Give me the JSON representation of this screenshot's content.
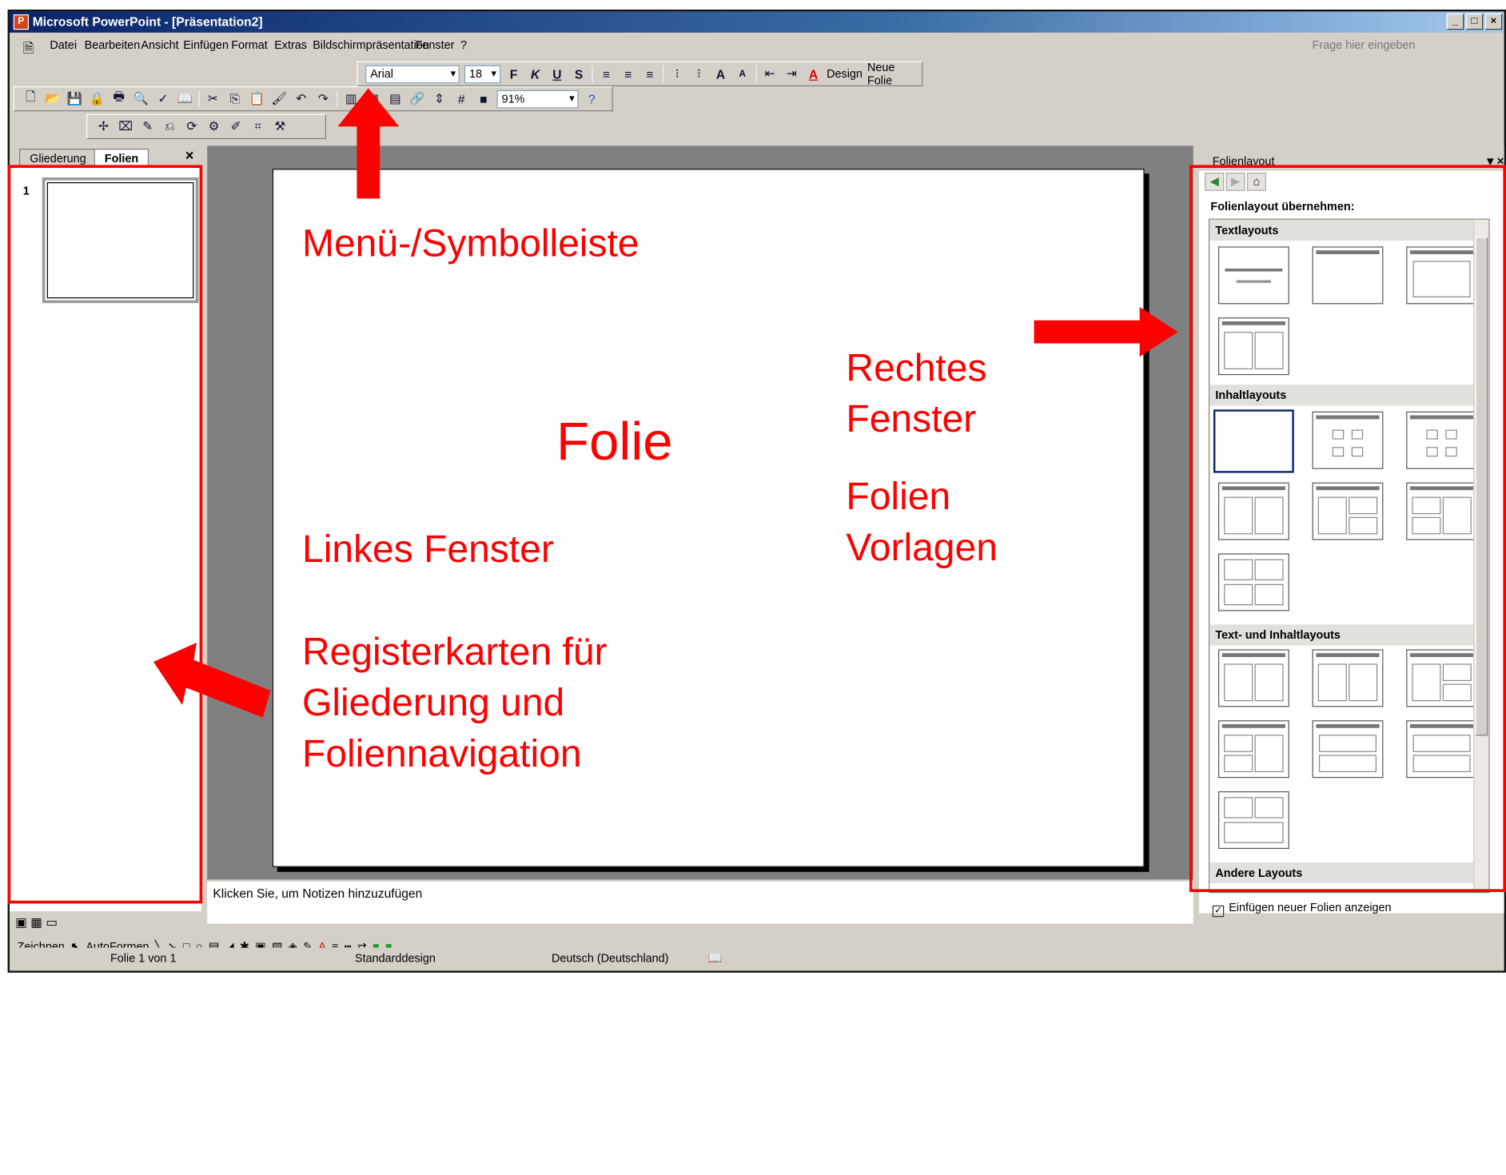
{
  "window": {
    "title": "Microsoft PowerPoint - [Präsentation2]",
    "app_icon": "powerpoint-icon"
  },
  "menu": [
    "Datei",
    "Bearbeiten",
    "Ansicht",
    "Einfügen",
    "Format",
    "Extras",
    "Bildschirmpräsentation",
    "Fenster",
    "?"
  ],
  "help_placeholder": "Frage hier eingeben",
  "formatting": {
    "font": "Arial",
    "size": "18",
    "bold": "F",
    "italic": "K",
    "underline": "U",
    "shadow": "S",
    "design": "Design",
    "new_slide": "Neue Folie"
  },
  "standard": {
    "zoom": "91%"
  },
  "left_pane": {
    "tab_outline": "Gliederung",
    "tab_slides": "Folien",
    "slide_number": "1"
  },
  "notes_placeholder": "Klicken Sie, um Notizen hinzuzufügen",
  "task_pane": {
    "title": "Folienlayout",
    "heading": "Folienlayout übernehmen:",
    "sections": [
      "Textlayouts",
      "Inhaltlayouts",
      "Text- und Inhaltlayouts",
      "Andere Layouts"
    ],
    "footer_checkbox": "Einfügen neuer Folien anzeigen"
  },
  "draw_toolbar": {
    "draw": "Zeichnen",
    "autoshapes": "AutoFormen"
  },
  "status": {
    "slide": "Folie 1 von 1",
    "design": "Standarddesign",
    "language": "Deutsch (Deutschland)"
  },
  "annotations": {
    "menu": "Menü-/Symbolleiste",
    "slide": "Folie",
    "left": "Linkes Fenster",
    "tabs_line1": "Registerkarten für",
    "tabs_line2": "Gliederung und",
    "tabs_line3": "Foliennavigation",
    "right_line1": "Rechtes",
    "right_line2": "Fenster",
    "templates_line1": "Folien",
    "templates_line2": "Vorlagen"
  },
  "colors": {
    "annotation": "#ff0000",
    "title_bar": "#0a246a"
  }
}
